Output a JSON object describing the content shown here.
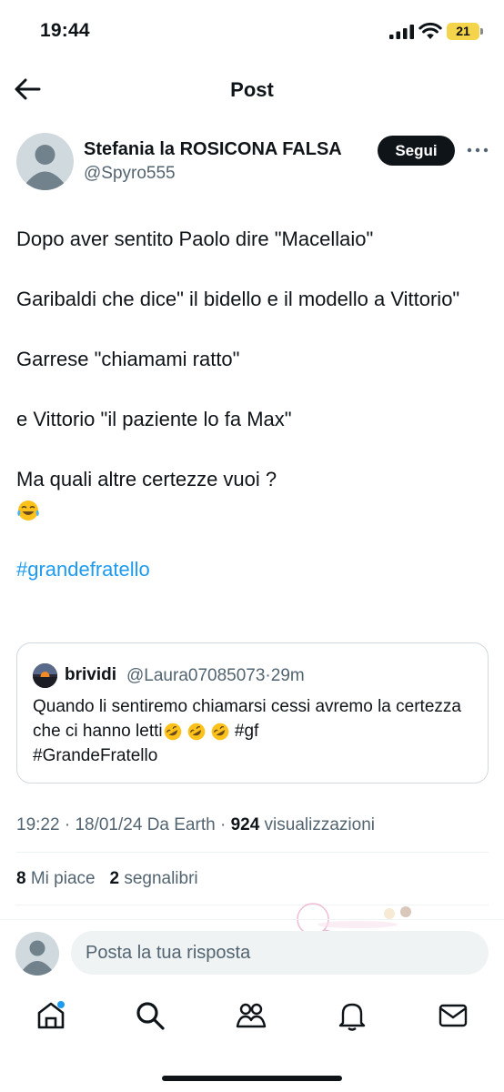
{
  "status_bar": {
    "time": "19:44",
    "battery": "21"
  },
  "header": {
    "title": "Post"
  },
  "author": {
    "display_name": "Stefania la ROSICONA FALSA",
    "handle": "@Spyro555",
    "follow_label": "Segui"
  },
  "post": {
    "lines": [
      "Dopo aver sentito Paolo dire \"Macellaio\"",
      "Garibaldi che dice\" il bidello e il modello a Vittorio\"",
      "Garrese \"chiamami ratto\"",
      "e Vittorio \"il paziente lo fa Max\"",
      "Ma quali altre certezze vuoi ?"
    ],
    "emoji": "face-with-tears-of-joy",
    "hashtag": "#grandefratello"
  },
  "quote": {
    "name": "brividi",
    "handle": "@Laura07085073",
    "separator": "·",
    "time_ago": "29m",
    "text_part1": "Quando li sentiremo chiamarsi cessi avremo la certezza che ci hanno letti",
    "text_hashtag1": "#gf",
    "text_hashtag2": "#GrandeFratello",
    "emoji": "rolling-on-floor-laughing"
  },
  "info": {
    "time": "19:22",
    "sep1": "·",
    "date": "18/01/24",
    "source": "Da Earth",
    "sep2": "·",
    "views": "924",
    "views_label": "visualizzazioni"
  },
  "stats": {
    "likes": "8",
    "likes_label": "Mi piace",
    "bookmarks": "2",
    "bookmarks_label": "segnalibri"
  },
  "reply": {
    "placeholder": "Posta la tua risposta"
  },
  "tabs": [
    "home-icon",
    "search-icon",
    "communities-icon",
    "notifications-icon",
    "messages-icon"
  ],
  "colors": {
    "accent": "#1d9bf0",
    "text": "#0f1419",
    "secondary": "#536471",
    "battery": "#f4d44a"
  }
}
